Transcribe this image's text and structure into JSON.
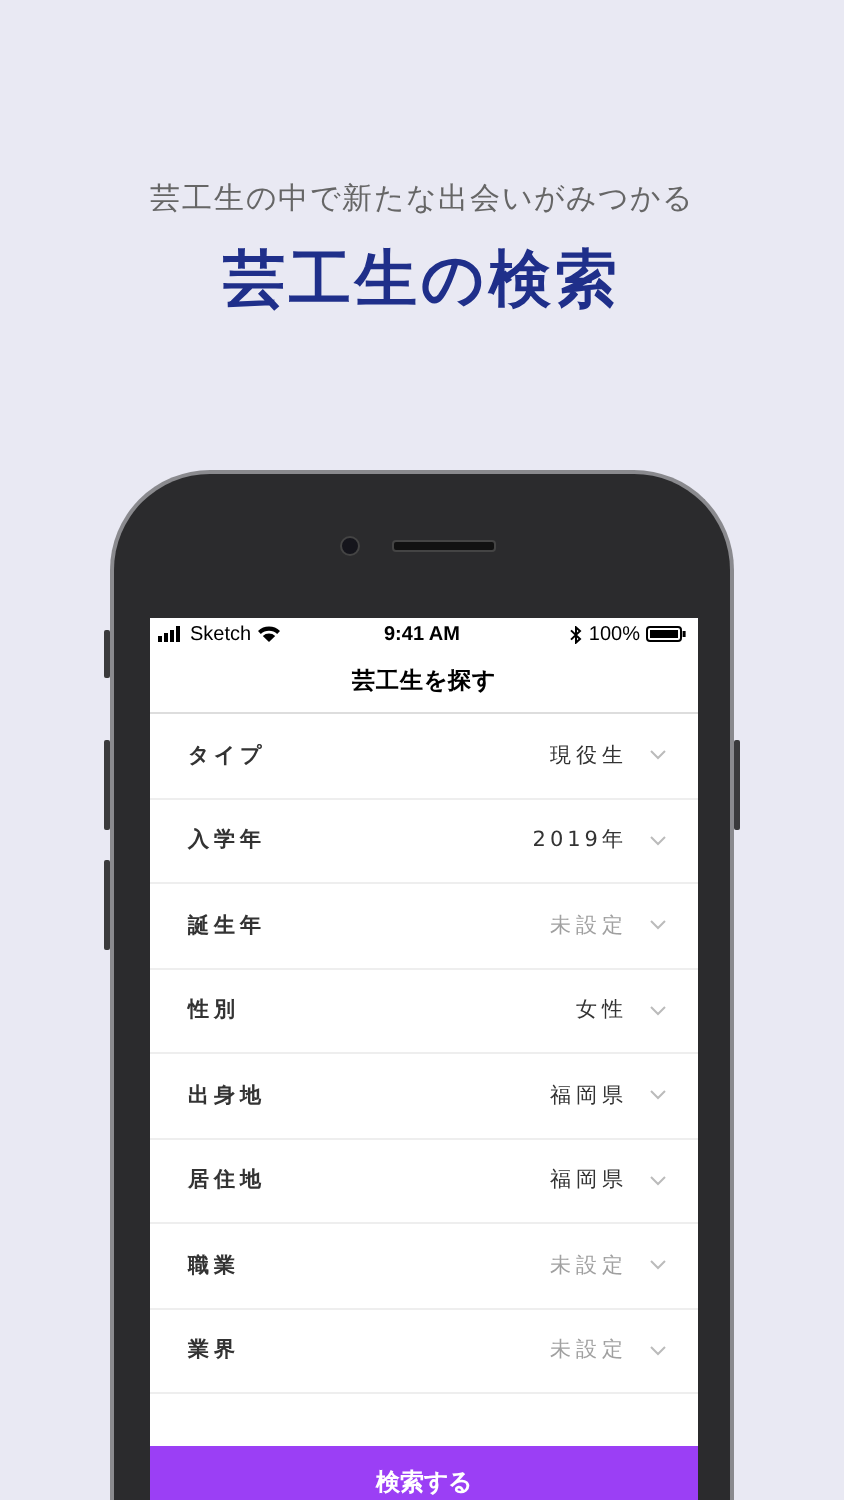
{
  "header": {
    "subtitle": "芸工生の中で新たな出会いがみつかる",
    "title": "芸工生の検索"
  },
  "status_bar": {
    "carrier": "Sketch",
    "time": "9:41 AM",
    "battery": "100%"
  },
  "nav": {
    "title": "芸工生を探す"
  },
  "filters": [
    {
      "label": "タイプ",
      "value": "現役生",
      "set": true
    },
    {
      "label": "入学年",
      "value": "2019年",
      "set": true
    },
    {
      "label": "誕生年",
      "value": "未設定",
      "set": false
    },
    {
      "label": "性別",
      "value": "女性",
      "set": true
    },
    {
      "label": "出身地",
      "value": "福岡県",
      "set": true
    },
    {
      "label": "居住地",
      "value": "福岡県",
      "set": true
    },
    {
      "label": "職業",
      "value": "未設定",
      "set": false
    },
    {
      "label": "業界",
      "value": "未設定",
      "set": false
    }
  ],
  "search_button": {
    "label": "検索する"
  }
}
